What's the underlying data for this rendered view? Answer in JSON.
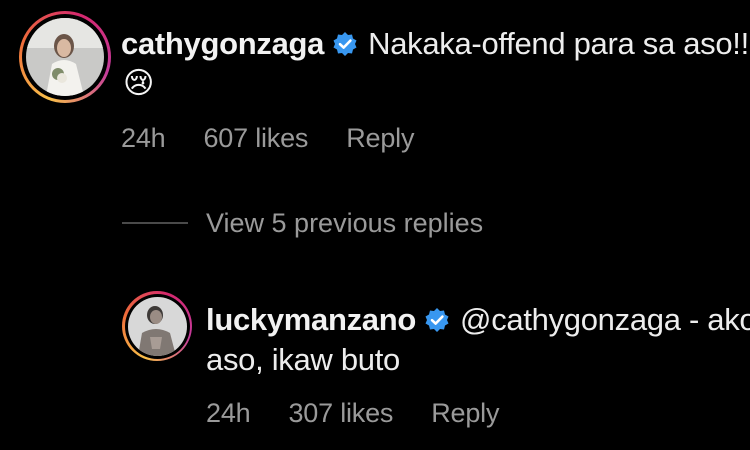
{
  "comments": [
    {
      "username": "cathygonzaga",
      "text": "Nakaka-offend para sa aso!!!",
      "emoji": "😢",
      "time": "24h",
      "likes": "607 likes",
      "reply_label": "Reply"
    },
    {
      "username": "luckymanzano",
      "text_line1": "@cathygonzaga - ako",
      "text_line2": "aso, ikaw buto",
      "time": "24h",
      "likes": "307 likes",
      "reply_label": "Reply"
    }
  ],
  "thread": {
    "view_replies_label": "View 5 previous replies"
  },
  "colors": {
    "background": "#000000",
    "verified_badge": "#3897f0",
    "meta_text": "#9a9a9a"
  },
  "icons": [
    "verified-badge-icon",
    "crying-face-emoji"
  ]
}
